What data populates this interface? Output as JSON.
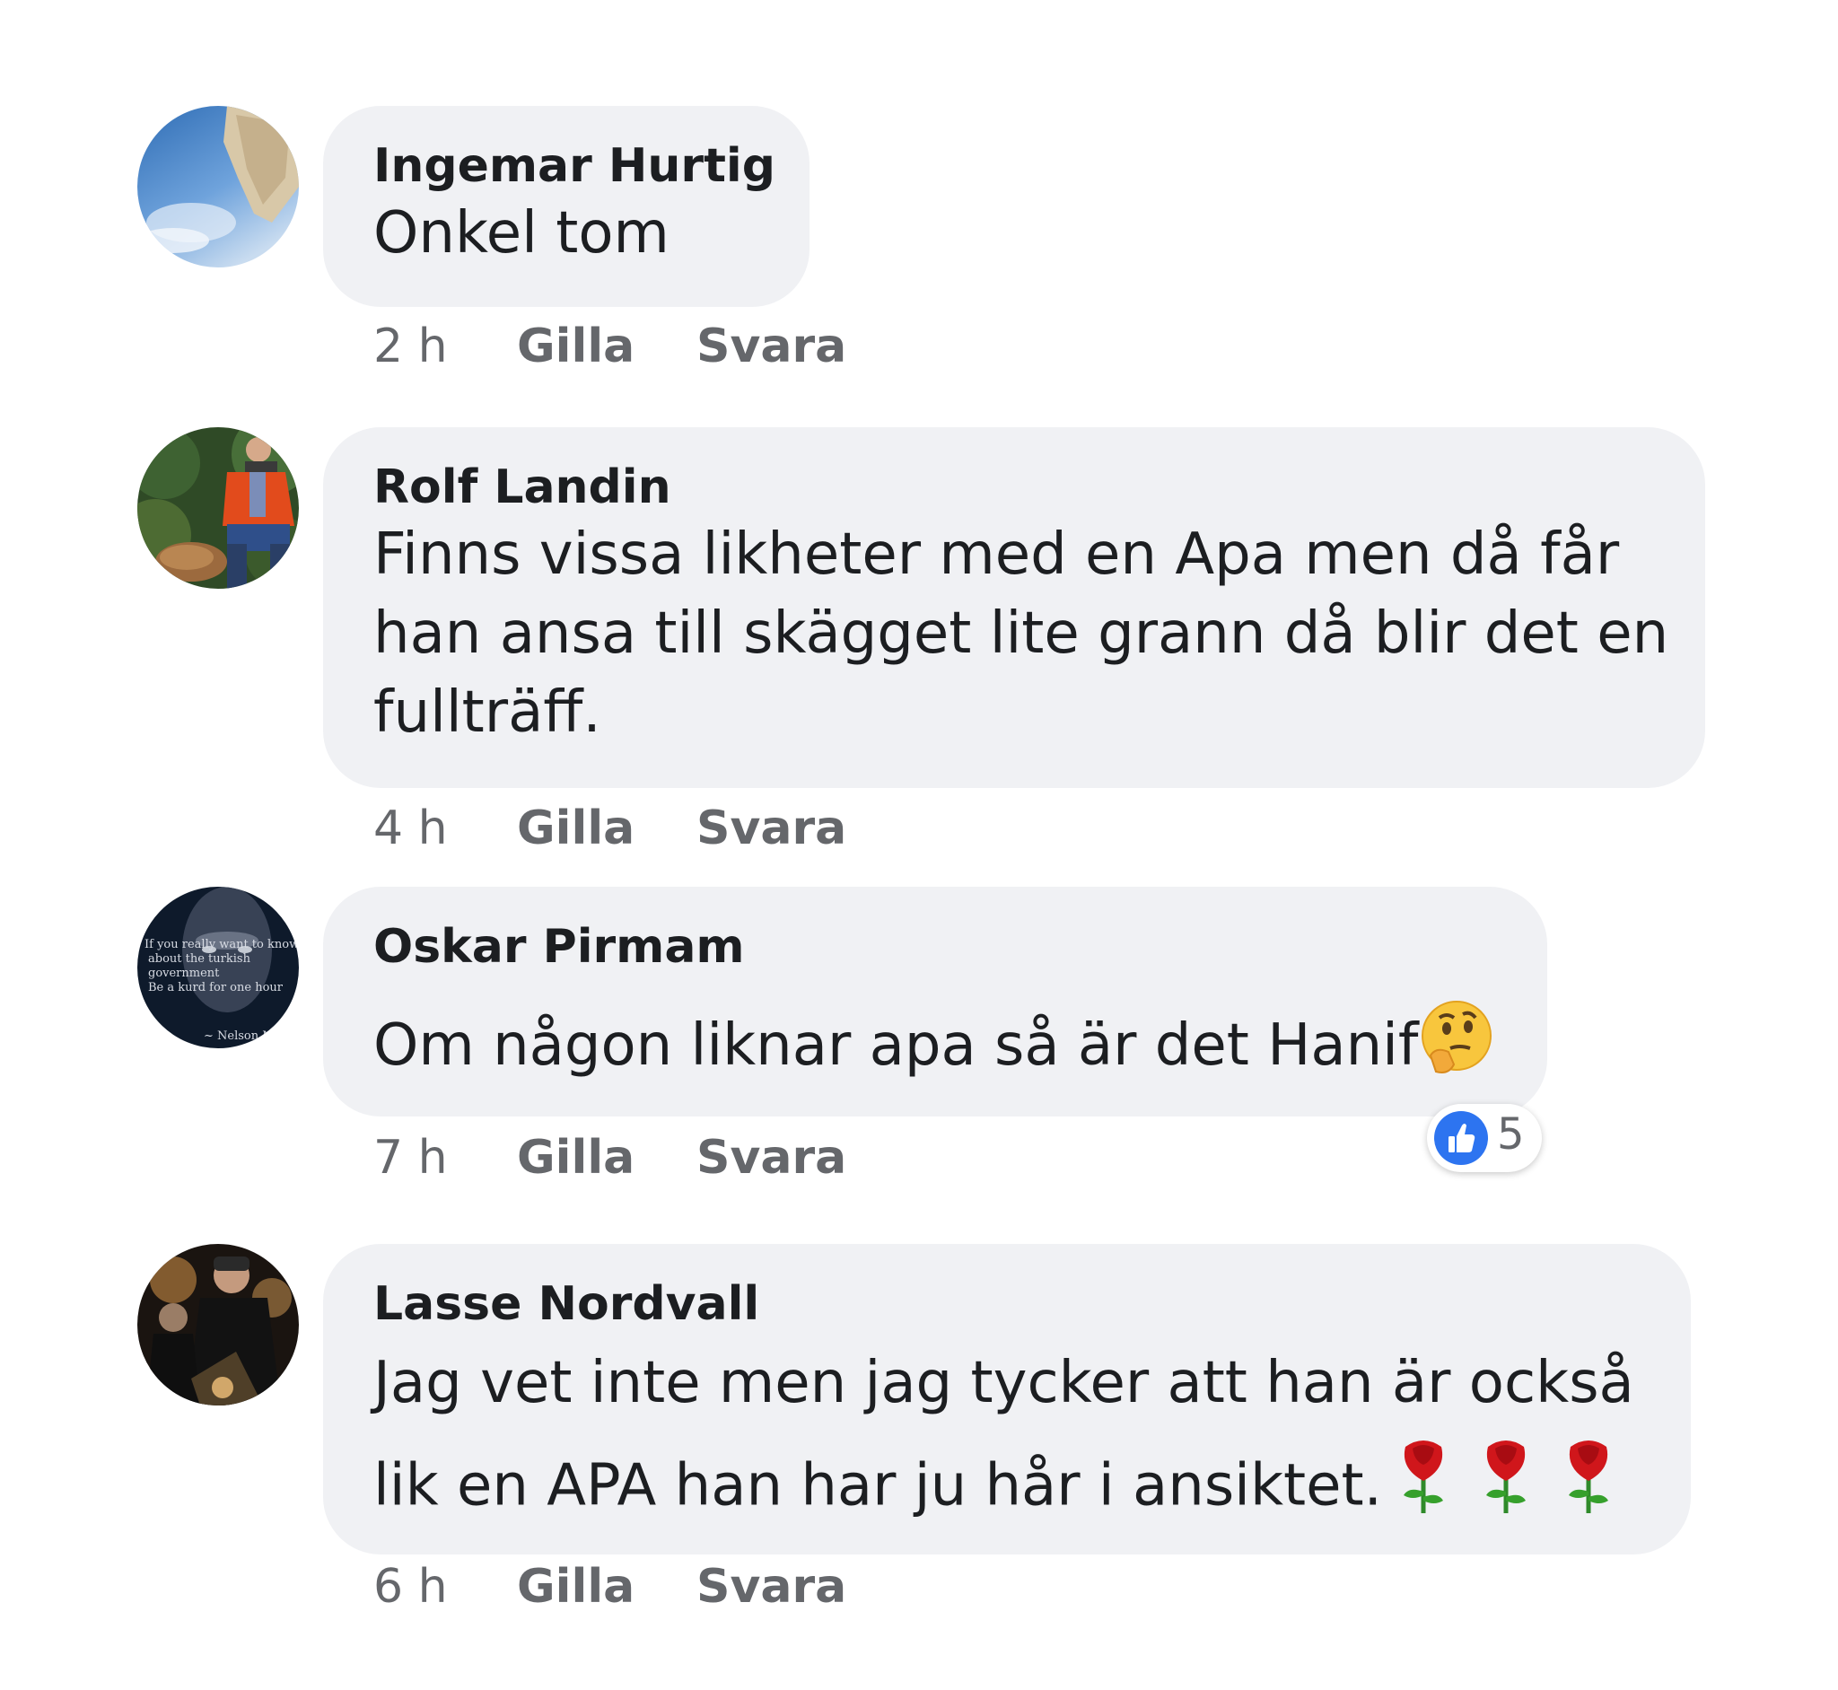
{
  "comments": [
    {
      "author": "Ingemar Hurtig",
      "lines": [
        "Onkel tom"
      ],
      "time": "2 h",
      "like_label": "Gilla",
      "reply_label": "Svara"
    },
    {
      "author": "Rolf Landin",
      "lines": [
        "Finns vissa likheter med en Apa men då får",
        "han ansa till skägget lite grann då blir det en",
        "fullträff."
      ],
      "time": "4 h",
      "like_label": "Gilla",
      "reply_label": "Svara"
    },
    {
      "author": "Oskar Pirmam",
      "lines": [
        "Om någon liknar apa så är det Hanif"
      ],
      "time": "7 h",
      "like_label": "Gilla",
      "reply_label": "Svara",
      "reaction_count": "5",
      "emoji": "thinking-face-icon"
    },
    {
      "author": "Lasse Nordvall",
      "lines": [
        "Jag vet inte men jag tycker att han är också",
        "lik en APA han har ju hår i ansiktet."
      ],
      "time": "6 h",
      "like_label": "Gilla",
      "reply_label": "Svara",
      "emoji": "rose-icon",
      "emoji_count": 3
    }
  ],
  "avatar_texts": {
    "oskar": [
      "If you really want to know",
      "about the turkish",
      "government",
      "Be a kurd for one hour",
      "~ Nelson M"
    ]
  },
  "colors": {
    "bubble": "#f0f1f4",
    "text": "#1c1e21",
    "meta": "#65676b",
    "like_blue": "#2d74f0"
  }
}
